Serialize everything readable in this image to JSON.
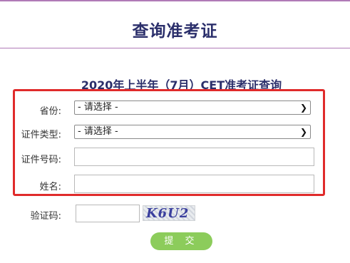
{
  "header": {
    "title": "查询准考证"
  },
  "form": {
    "title": "2020年上半年（7月）CET准考证查询",
    "province": {
      "label": "省份:",
      "value": "- 请选择 -"
    },
    "id_type": {
      "label": "证件类型:",
      "value": "- 请选择 -"
    },
    "id_number": {
      "label": "证件号码:",
      "value": ""
    },
    "name": {
      "label": "姓名:",
      "value": ""
    },
    "captcha": {
      "label": "验证码:",
      "value": "",
      "image_text": "K6U2"
    },
    "submit_label": "提 交"
  },
  "colors": {
    "title": "#2b2f6b",
    "rule": "#b07ab7",
    "highlight_border": "#e02b2b",
    "submit_bg": "#8ccc5b"
  },
  "icons": {
    "select_arrow": "chevron-down-icon"
  }
}
